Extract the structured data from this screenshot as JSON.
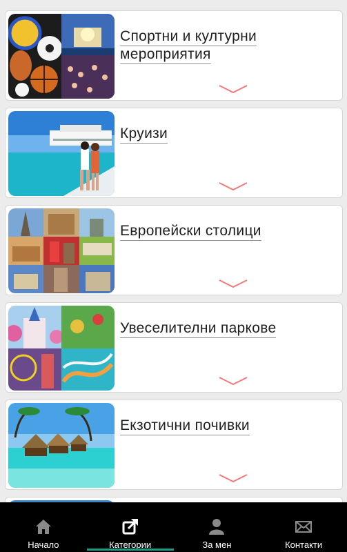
{
  "categories": [
    {
      "title_line1": "Спортни и културни",
      "title_line2": "мероприятия",
      "image": "sports-concert-collage"
    },
    {
      "title_line1": "Круизи",
      "title_line2": "",
      "image": "cruise-ship-couple"
    },
    {
      "title_line1": "Европейски столици",
      "title_line2": "",
      "image": "european-capitals-collage"
    },
    {
      "title_line1": "Увеселителни паркове",
      "title_line2": "",
      "image": "amusement-parks-collage"
    },
    {
      "title_line1": "Екзотични почивки",
      "title_line2": "",
      "image": "tropical-bungalows"
    }
  ],
  "chevron_color": "#f07a7a",
  "nav": {
    "items": [
      {
        "label": "Начало",
        "icon": "home-icon"
      },
      {
        "label": "Категории",
        "icon": "share-icon"
      },
      {
        "label": "За мен",
        "icon": "person-icon"
      },
      {
        "label": "Контакти",
        "icon": "envelope-icon"
      }
    ],
    "active_index": 1,
    "indicator_color": "#1a9e8b"
  }
}
